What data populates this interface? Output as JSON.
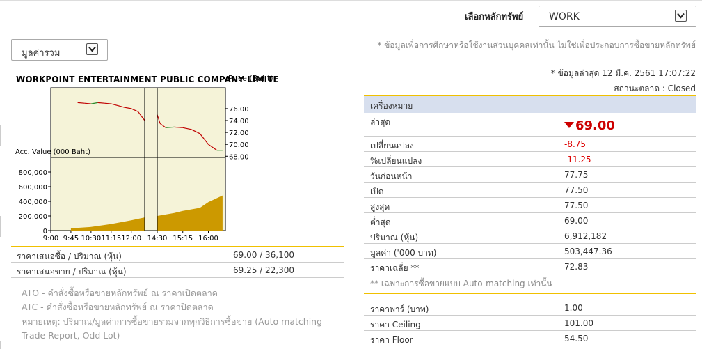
{
  "header": {
    "symbol_label": "เลือกหลักทรัพย์",
    "symbol_value": "WORK",
    "mode_value": "มูลค่ารวม"
  },
  "notes": {
    "disclaimer": "* ข้อมูลเพื่อการศึกษาหรือใช้งานส่วนบุคคลเท่านั้น ไม่ใช่เพื่อประกอบการซื้อขายหลักทรัพย์",
    "updated": "* ข้อมูลล่าสุด 12 มี.ค. 2561 17:07:22",
    "market_status": "สถานะตลาด : Closed"
  },
  "chart": {
    "title": "WORKPOINT ENTERTAINMENT PUBLIC COMPANY LIMITE",
    "price_label": "Price (Baht)",
    "volume_label": "Acc. Value (000 Baht)"
  },
  "chart_data": {
    "type": "line",
    "title": "WORKPOINT ENTERTAINMENT PUBLIC COMPANY LIMITE",
    "price_axis": {
      "label": "Price (Baht)",
      "ticks": [
        76.0,
        74.0,
        72.0,
        70.0,
        68.0
      ],
      "ylim": [
        67.8,
        79.5
      ]
    },
    "value_axis": {
      "label": "Acc. Value (000 Baht)",
      "ticks": [
        0,
        200000,
        400000,
        600000,
        800000
      ],
      "ylim": [
        0,
        1000000
      ]
    },
    "x_ticks": [
      "9:00",
      "9:45",
      "10:30",
      "11:15",
      "12:00",
      "14:30",
      "15:15",
      "16:00"
    ],
    "price_series": [
      [
        "10:00",
        77.0
      ],
      [
        "10:15",
        76.9
      ],
      [
        "10:30",
        76.8
      ],
      [
        "10:45",
        77.0
      ],
      [
        "11:00",
        76.9
      ],
      [
        "11:15",
        76.8
      ],
      [
        "11:30",
        76.5
      ],
      [
        "11:45",
        76.2
      ],
      [
        "12:00",
        76.0
      ],
      [
        "12:15",
        75.5
      ],
      [
        "12:30",
        74.0
      ],
      [
        "14:30",
        75.0
      ],
      [
        "14:35",
        73.5
      ],
      [
        "14:45",
        72.8
      ],
      [
        "15:00",
        72.9
      ],
      [
        "15:15",
        72.8
      ],
      [
        "15:30",
        72.5
      ],
      [
        "15:45",
        71.8
      ],
      [
        "16:00",
        70.0
      ],
      [
        "16:15",
        69.0
      ],
      [
        "16:25",
        69.0
      ]
    ],
    "value_series": [
      [
        "9:45",
        30000
      ],
      [
        "10:30",
        50000
      ],
      [
        "11:15",
        90000
      ],
      [
        "12:00",
        140000
      ],
      [
        "12:30",
        180000
      ],
      [
        "14:30",
        200000
      ],
      [
        "15:00",
        240000
      ],
      [
        "15:15",
        270000
      ],
      [
        "15:45",
        310000
      ],
      [
        "16:00",
        390000
      ],
      [
        "16:25",
        480000
      ]
    ]
  },
  "bidask": [
    {
      "label": "ราคาเสนอซื้อ / ปริมาณ (หุ้น)",
      "value": "69.00  /  36,100"
    },
    {
      "label": "ราคาเสนอขาย / ปริมาณ (หุ้น)",
      "value": "69.25  /  22,300"
    }
  ],
  "legend": {
    "ato": "ATO - คำสั่งซื้อหรือขายหลักทรัพย์ ณ ราคาเปิดตลาด",
    "atc": "ATC - คำสั่งซื้อหรือขายหลักทรัพย์ ณ ราคาปิดตลาด",
    "remark": "หมายเหตุ: ปริมาณ/มูลค่าการซื้อขายรวมจากทุกวิธีการซื้อขาย (Auto matching Trade Report, Odd Lot)"
  },
  "quote": {
    "header": "เครื่องหมาย",
    "last_label": "ล่าสุด",
    "last_value": "69.00",
    "change_label": "เปลี่ยนแปลง",
    "change_value": "-8.75",
    "pct_label": "%เปลี่ยนแปลง",
    "pct_value": "-11.25",
    "prev_label": "วันก่อนหน้า",
    "prev_value": "77.75",
    "open_label": "เปิด",
    "open_value": "77.50",
    "high_label": "สูงสุด",
    "high_value": "77.50",
    "low_label": "ต่ำสุด",
    "low_value": "69.00",
    "vol_label": "ปริมาณ (หุ้น)",
    "vol_value": "6,912,182",
    "valu_label": "มูลค่า ('000 บาท)",
    "valu_value": "503,447.36",
    "avg_label": "ราคาเฉลี่ย **",
    "avg_value": "72.83",
    "note": "** เฉพาะการซื้อขายแบบ Auto-matching เท่านั้น",
    "par_label": "ราคาพาร์ (บาท)",
    "par_value": "1.00",
    "ceil_label": "ราคา Ceiling",
    "ceil_value": "101.00",
    "floor_label": "ราคา Floor",
    "floor_value": "54.50"
  },
  "colors": {
    "accent": "#f0c000",
    "header_bg": "#d7dfee",
    "down": "#cc0000",
    "plot_bg": "#f5f3d8",
    "volume": "#cc9900"
  }
}
